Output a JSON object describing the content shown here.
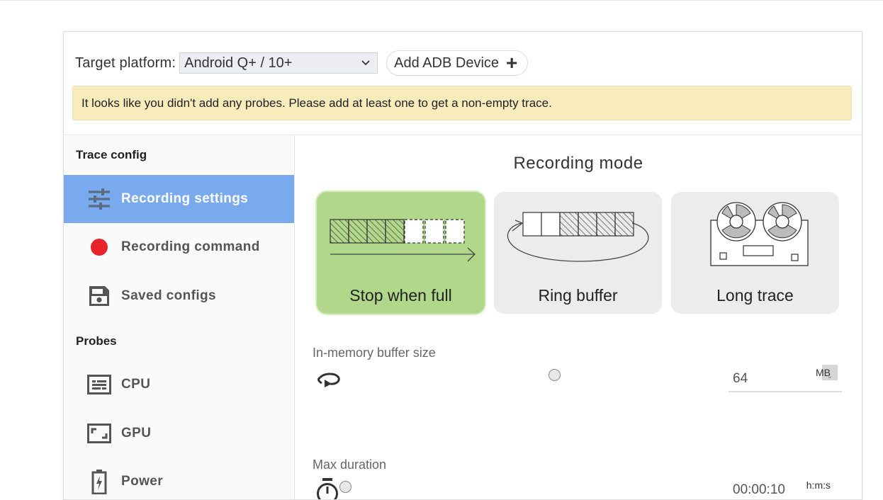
{
  "platform": {
    "label": "Target platform:",
    "selected": "Android Q+ / 10+",
    "add_device": "Add ADB Device"
  },
  "warning": "It looks like you didn't add any probes. Please add at least one to get a non-empty trace.",
  "sidebar": {
    "trace_config_title": "Trace config",
    "trace_items": [
      {
        "label": "Recording settings",
        "icon": "sliders-icon",
        "active": true
      },
      {
        "label": "Recording command",
        "icon": "record-dot-icon",
        "active": false
      },
      {
        "label": "Saved configs",
        "icon": "save-icon",
        "active": false
      }
    ],
    "probes_title": "Probes",
    "probe_items": [
      {
        "label": "CPU",
        "icon": "cpu-icon"
      },
      {
        "label": "GPU",
        "icon": "gpu-icon"
      },
      {
        "label": "Power",
        "icon": "battery-icon"
      }
    ]
  },
  "recording": {
    "title": "Recording mode",
    "modes": [
      {
        "label": "Stop when full",
        "selected": true
      },
      {
        "label": "Ring buffer",
        "selected": false
      },
      {
        "label": "Long trace",
        "selected": false
      }
    ],
    "buffer": {
      "label": "In-memory buffer size",
      "value": "64",
      "unit": "MB"
    },
    "duration": {
      "label": "Max duration",
      "value": "00:00:10",
      "unit": "h:m:s"
    }
  },
  "colors": {
    "active_nav": "#7aaaee",
    "selected_mode": "#b0d78a",
    "warning_bg": "#f8ecbc",
    "record_dot": "#e8232a"
  }
}
